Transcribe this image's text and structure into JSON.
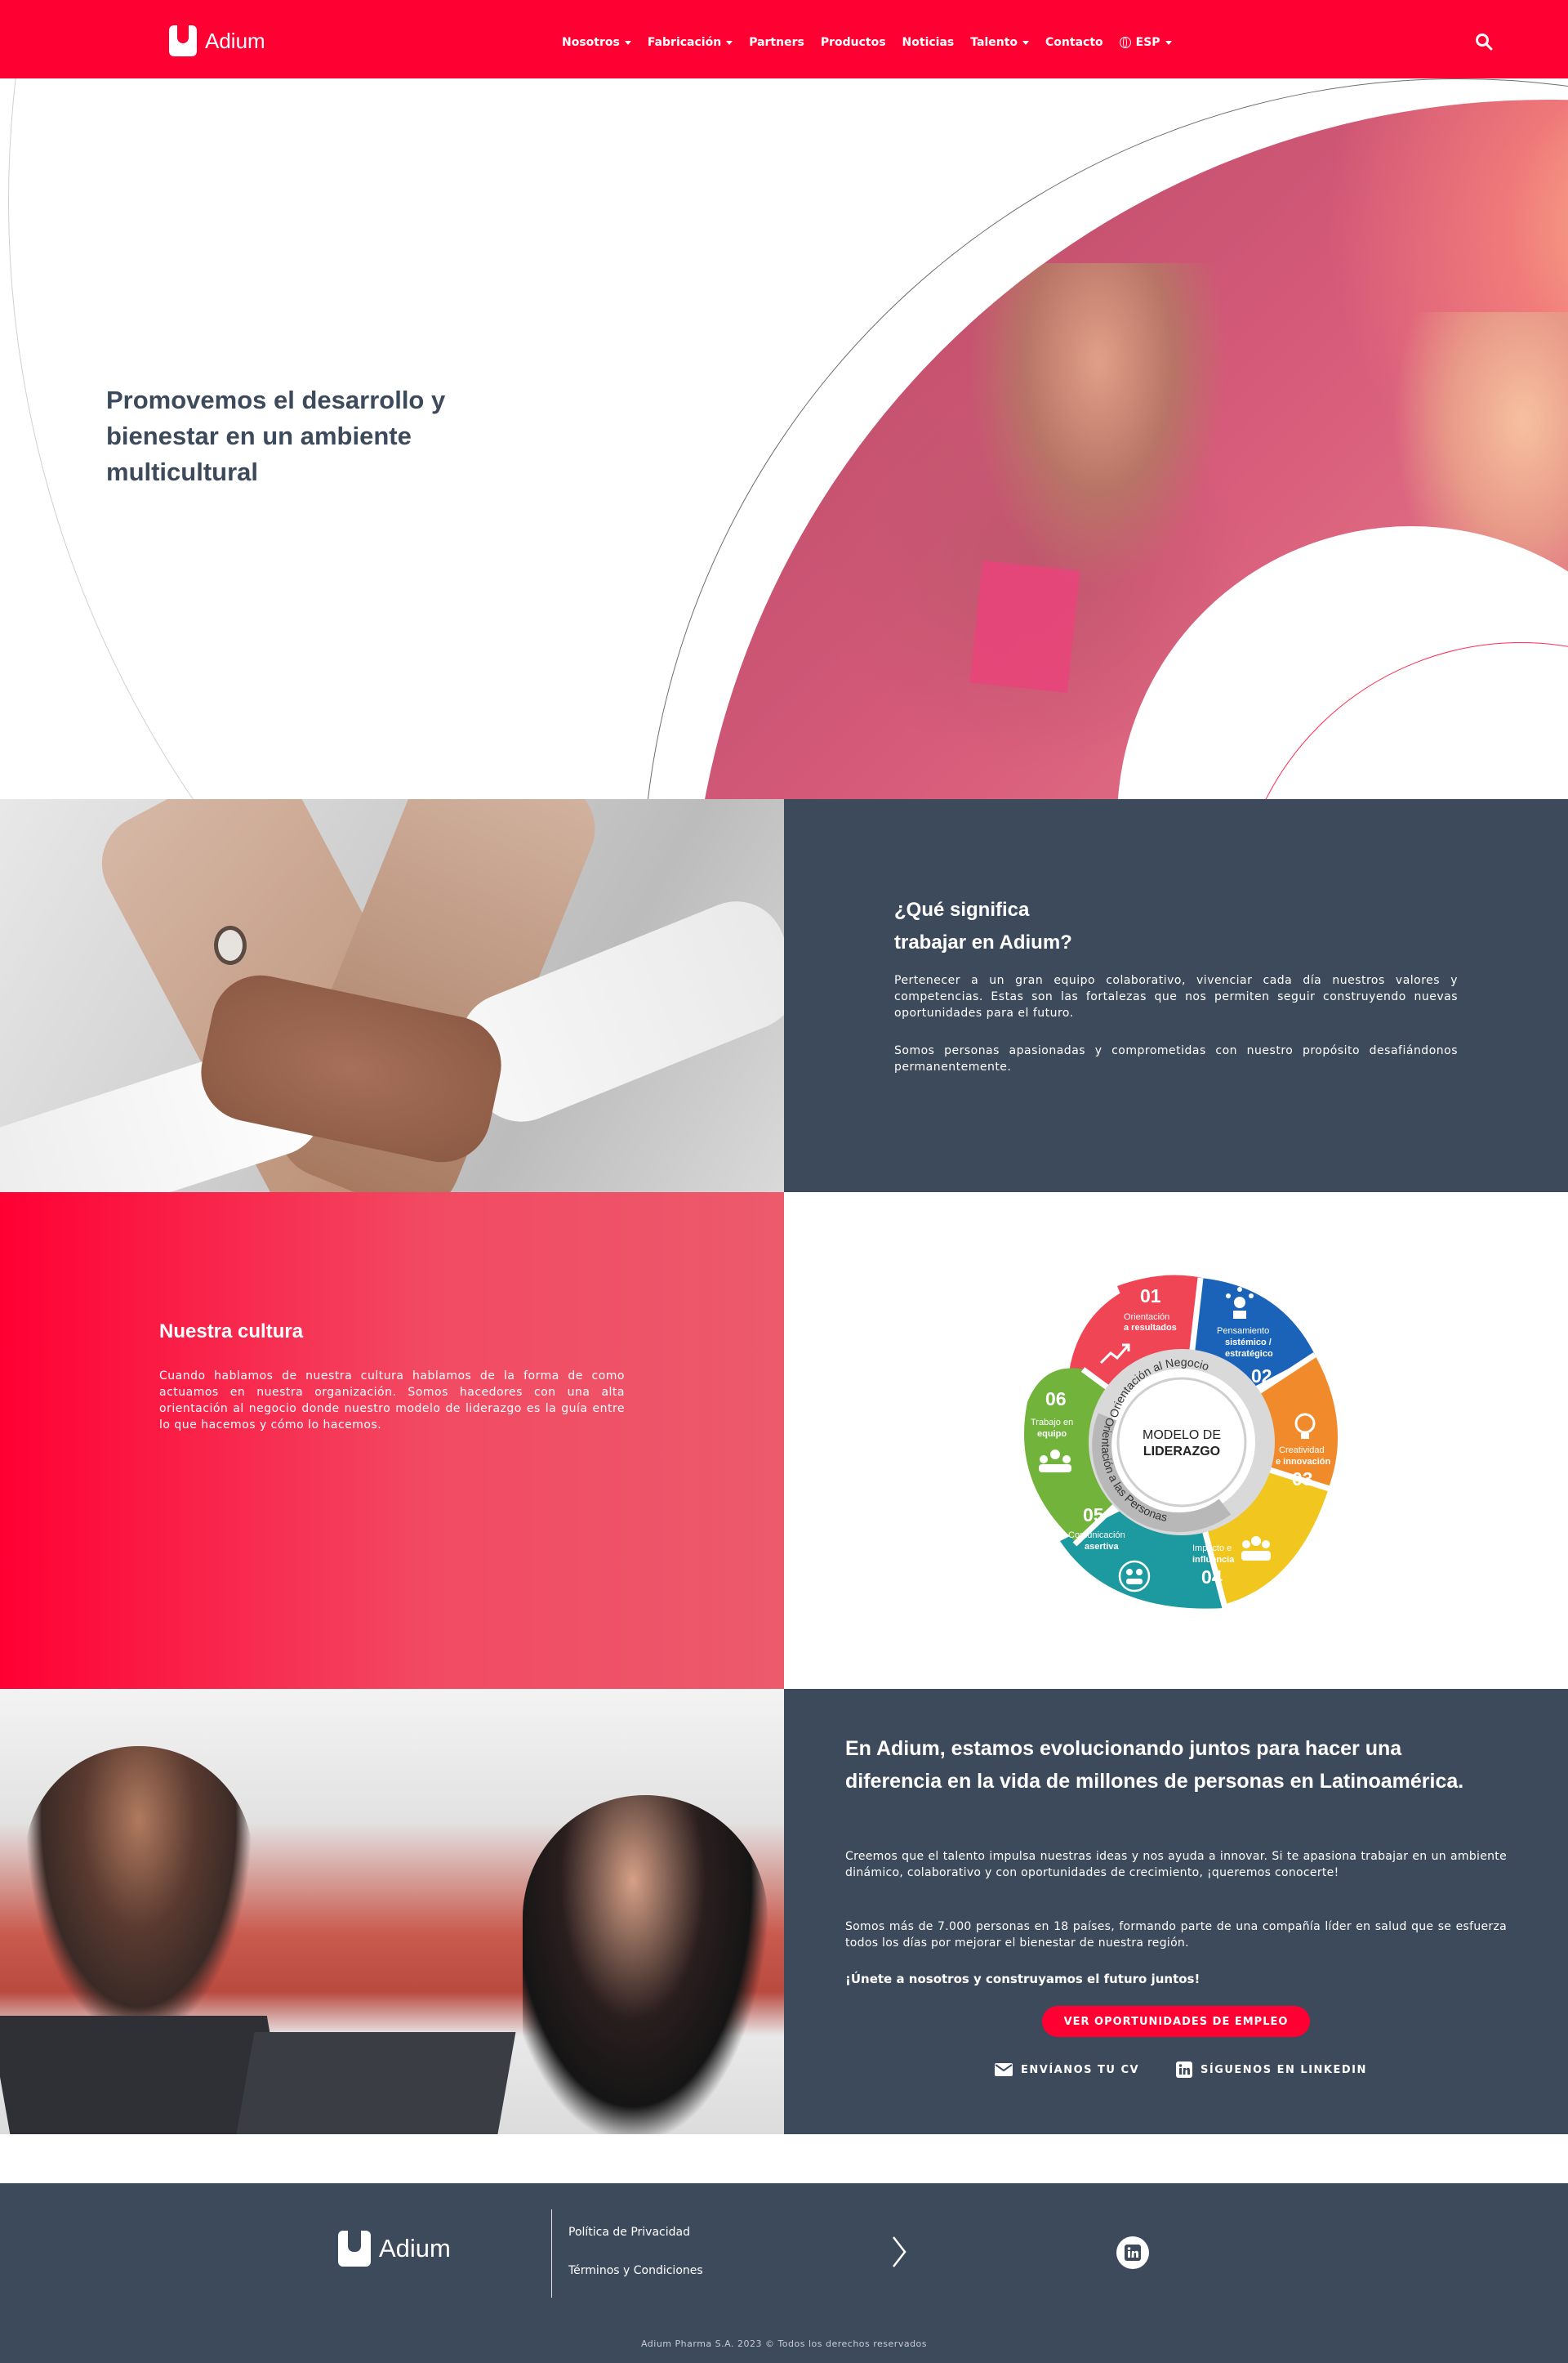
{
  "header": {
    "brand": "Adium",
    "nav": [
      {
        "label": "Nosotros",
        "dropdown": true
      },
      {
        "label": "Fabricación",
        "dropdown": true
      },
      {
        "label": "Partners",
        "dropdown": false
      },
      {
        "label": "Productos",
        "dropdown": false
      },
      {
        "label": "Noticias",
        "dropdown": false
      },
      {
        "label": "Talento",
        "dropdown": true
      },
      {
        "label": "Contacto",
        "dropdown": false
      }
    ],
    "language": "ESP",
    "search_icon": "search-icon",
    "bg_color": "#ff0032"
  },
  "hero": {
    "title": "Promovemos el desarrollo y bienestar en un ambiente multicultural"
  },
  "section_work": {
    "title_line1": "¿Qué significa",
    "title_line2": "trabajar en Adium?",
    "paragraph1": "Pertenecer a un gran equipo colaborativo, vivenciar cada día nuestros valores y competencias. Estas son las fortalezas que nos permiten seguir construyendo nuevas oportunidades para el futuro.",
    "paragraph2": "Somos personas apasionadas y comprometidas con nuestro propósito desafiándonos permanentemente.",
    "bg_color": "#3c4a5c"
  },
  "section_culture": {
    "title": "Nuestra cultura",
    "paragraph": "Cuando hablamos de nuestra cultura hablamos de la forma de como actuamos en nuestra organización. Somos hacedores con una alta orientación al negocio donde nuestro modelo de liderazgo es la guía entre lo que hacemos y cómo lo hacemos.",
    "model": {
      "center_line1": "MODELO DE",
      "center_line2": "LIDERAZGO",
      "ring_top": "Orientación al Negocio",
      "ring_bottom": "Orientación a las Personas",
      "segments": [
        {
          "num": "01",
          "line1": "Orientación",
          "line2": "a resultados",
          "color": "#ef4554",
          "icon": "chart-up-icon"
        },
        {
          "num": "02",
          "line1": "Pensamiento",
          "line2": "sistémico /",
          "line3": "estratégico",
          "color": "#1a63b8",
          "icon": "network-icon"
        },
        {
          "num": "03",
          "line1": "Creatividad",
          "line2": "e innovación",
          "color": "#f18a2b",
          "icon": "lightbulb-icon"
        },
        {
          "num": "04",
          "line1": "Impacto e",
          "line2": "influencia",
          "color": "#f0c61f",
          "icon": "people-influence-icon"
        },
        {
          "num": "05",
          "line1": "Comunicación",
          "line2": "asertiva",
          "color": "#1c9aa0",
          "icon": "communication-icon"
        },
        {
          "num": "06",
          "line1": "Trabajo en",
          "line2": "equipo",
          "color": "#72b33c",
          "icon": "team-icon"
        }
      ]
    }
  },
  "section_evolve": {
    "title": "En Adium, estamos evolucionando juntos para hacer una diferencia en la vida de millones de personas en Latinoamérica.",
    "paragraph1": "Creemos que el talento impulsa nuestras ideas y nos ayuda a innovar. Si te apasiona trabajar en un ambiente dinámico, colaborativo y con oportunidades de crecimiento, ¡queremos conocerte!",
    "paragraph2": "Somos más de 7.000 personas en 18 países, formando parte de una compañía líder en salud que se esfuerza todos los días por mejorar el bienestar de nuestra región.",
    "cta_text": "¡Únete a nosotros y construyamos el futuro juntos!",
    "button_label": "VER OPORTUNIDADES DE EMPLEO",
    "send_cv_label": "ENVÍANOS TU CV",
    "linkedin_label": "SÍGUENOS EN LINKEDIN"
  },
  "footer": {
    "brand": "Adium",
    "links": [
      "Política de Privacidad",
      "Términos y Condiciones"
    ],
    "copyright": "Adium Pharma S.A. 2023 © Todos los derechos reservados",
    "bg_color": "#3c4a5c"
  }
}
